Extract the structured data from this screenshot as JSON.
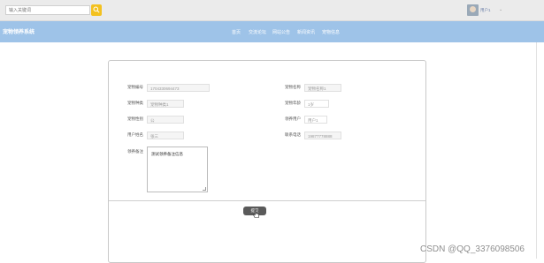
{
  "topbar": {
    "search_placeholder": "输入关键词",
    "username": "用户1",
    "chevron": "⌄"
  },
  "navbar": {
    "brand": "宠物领养系统",
    "items": [
      "首页",
      "交流论坛",
      "网站公告",
      "新闻资讯",
      "宠物信息"
    ]
  },
  "form": {
    "fields": [
      {
        "label": "宠物编号",
        "value": "1704330694473"
      },
      {
        "label": "宠物名称",
        "value": "宠物名称1"
      },
      {
        "label": "宠物种类",
        "value": "宠物种类1"
      },
      {
        "label": "宠物年龄",
        "value": "1岁"
      },
      {
        "label": "宠物性别",
        "value": "公"
      },
      {
        "label": "领养用户",
        "value": "用户1"
      },
      {
        "label": "用户姓名",
        "value": "张三"
      },
      {
        "label": "联系电话",
        "value": "19877778888"
      }
    ],
    "remark_label": "领养备注",
    "remark_value": "测试领养备注信息",
    "submit_label": "提交"
  },
  "watermark": "CSDN @QQ_3376098506"
}
